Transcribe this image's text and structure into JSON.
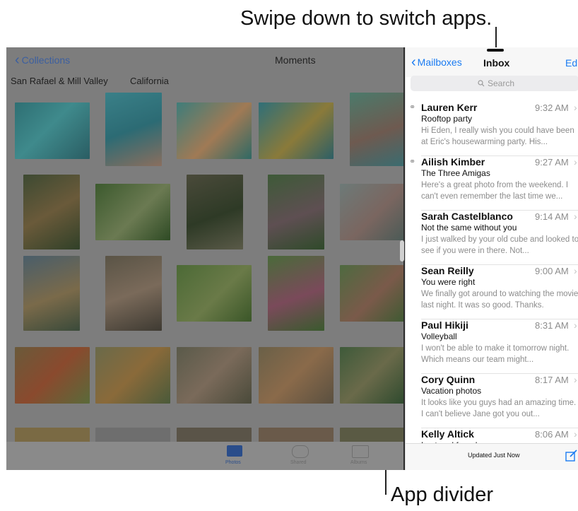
{
  "callouts": {
    "top": "Swipe down to switch apps.",
    "bottom": "App divider"
  },
  "photos": {
    "back_label": "Collections",
    "title": "Moments",
    "places": [
      "San Rafael & Mill Valley",
      "California"
    ],
    "tabs": [
      "Photos",
      "Shared",
      "Albums"
    ]
  },
  "mail": {
    "back_label": "Mailboxes",
    "title": "Inbox",
    "edit_label": "Edi",
    "search_placeholder": "Search",
    "status": "Updated Just Now",
    "messages": [
      {
        "sender": "Lauren Kerr",
        "time": "9:32 AM",
        "subject": "Rooftop party",
        "preview": "Hi Eden, I really wish you could have been at Eric's housewarming party. His...",
        "attachment": true
      },
      {
        "sender": "Ailish Kimber",
        "time": "9:27 AM",
        "subject": "The Three Amigas",
        "preview": "Here's a great photo from the weekend. I can't even remember the last time we...",
        "attachment": true
      },
      {
        "sender": "Sarah Castelblanco",
        "time": "9:14 AM",
        "subject": "Not the same without you",
        "preview": "I just walked by your old cube and looked to see if you were in there. Not...",
        "attachment": false
      },
      {
        "sender": "Sean Reilly",
        "time": "9:00 AM",
        "subject": "You were right",
        "preview": "We finally got around to watching the movie last night. It was so good. Thanks.",
        "attachment": false
      },
      {
        "sender": "Paul Hikiji",
        "time": "8:31 AM",
        "subject": "Volleyball",
        "preview": "I won't be able to make it tomorrow night. Which means our team might...",
        "attachment": false
      },
      {
        "sender": "Cory Quinn",
        "time": "8:17 AM",
        "subject": "Vacation photos",
        "preview": "It looks like you guys had an amazing time. I can't believe Jane got you out...",
        "attachment": false
      },
      {
        "sender": "Kelly Altick",
        "time": "8:06 AM",
        "subject": "Lost and found",
        "preview": "",
        "attachment": false
      }
    ]
  },
  "colors": {
    "accent": "#1a7bf2",
    "dim_overlay": "#7d7d7d"
  }
}
